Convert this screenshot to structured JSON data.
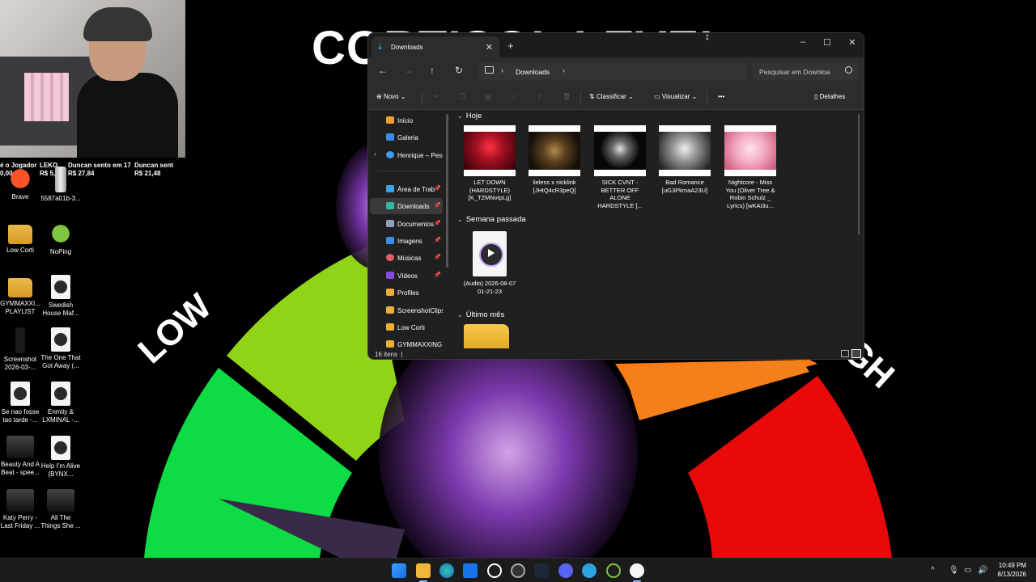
{
  "wallpaper": {
    "title": "CORTISOL LEVEL",
    "low_label": "LOW",
    "high_label": "GH"
  },
  "ticker": [
    "é o Jogador",
    "0,00",
    "LEKO",
    "R$ 5,00",
    "Duncan sento em 17",
    "R$ 27,84",
    "Duncan sent",
    "R$ 21,48"
  ],
  "desktop_icons": [
    {
      "label": "Brave",
      "icon": "brave-icon"
    },
    {
      "label": "5587a01b-3...",
      "icon": "file-icon"
    },
    {
      "label": "Low Corti",
      "icon": "folder-icon"
    },
    {
      "label": "NoPing",
      "icon": "noping-icon"
    },
    {
      "label": "GYMMAXXI... PLAYLIST",
      "icon": "folder-icon"
    },
    {
      "label": "Swedish House Maf...",
      "icon": "video-file-icon"
    },
    {
      "label": "Screenshot 2026-03-...",
      "icon": "image-file-icon"
    },
    {
      "label": "The One That Got Away (...",
      "icon": "video-file-icon"
    },
    {
      "label": "Se nao fosse tao tarde -...",
      "icon": "video-file-icon"
    },
    {
      "label": "Enmity & LXMINAL -...",
      "icon": "video-file-icon"
    },
    {
      "label": "Beauty And A Beat - spee...",
      "icon": "image-file-icon"
    },
    {
      "label": "Help I'm Alive (BYNX...",
      "icon": "video-file-icon"
    },
    {
      "label": "Katy Perry - Last Friday ...",
      "icon": "image-file-icon"
    },
    {
      "label": "All The Things She ...",
      "icon": "image-file-icon"
    }
  ],
  "explorer": {
    "tab_title": "Downloads",
    "breadcrumb": "Downloads",
    "search_placeholder": "Pesquisar em Downloa",
    "toolbar": {
      "new": "Novo",
      "sort": "Classificar",
      "view": "Visualizar",
      "more": "•••",
      "details": "Detalhes"
    },
    "sidebar": [
      {
        "label": "Início",
        "pin": false
      },
      {
        "label": "Galeria",
        "pin": false
      },
      {
        "label": "Henrique – Pess",
        "pin": false
      },
      {
        "label": "Área de Trab",
        "pin": true
      },
      {
        "label": "Downloads",
        "pin": true
      },
      {
        "label": "Documentos",
        "pin": true
      },
      {
        "label": "Imagens",
        "pin": true
      },
      {
        "label": "Músicas",
        "pin": true
      },
      {
        "label": "Vídeos",
        "pin": true
      },
      {
        "label": "Profiles",
        "pin": false
      },
      {
        "label": "ScreenshotClips",
        "pin": false
      },
      {
        "label": "Low Corti",
        "pin": false
      },
      {
        "label": "GYMMAXXING I",
        "pin": false
      }
    ],
    "groups": {
      "today": "Hoje",
      "last_week": "Semana passada",
      "last_month": "Último mês"
    },
    "files_today": [
      {
        "name": "LET DOWN (HARDSTYLE) [K_TZMNvIpLg]"
      },
      {
        "name": "lieless x nicklink [JHtQ4cR3peQ]"
      },
      {
        "name": "SICK CVNT - BETTER OFF ALONE HARDSTYLE [..."
      },
      {
        "name": "Bad Romance [uG3PkmaA23U]"
      },
      {
        "name": "Nightcore - Miss You (Oliver Tree & Robin Schulz _ Lyrics) [wKAi3u..."
      }
    ],
    "files_last_week": [
      {
        "name": "(Audio) 2026-08-07 01-21-23"
      }
    ],
    "status": "16 itens"
  },
  "taskbar": {
    "time": "10:49 PM",
    "date": "8/13/2026"
  }
}
